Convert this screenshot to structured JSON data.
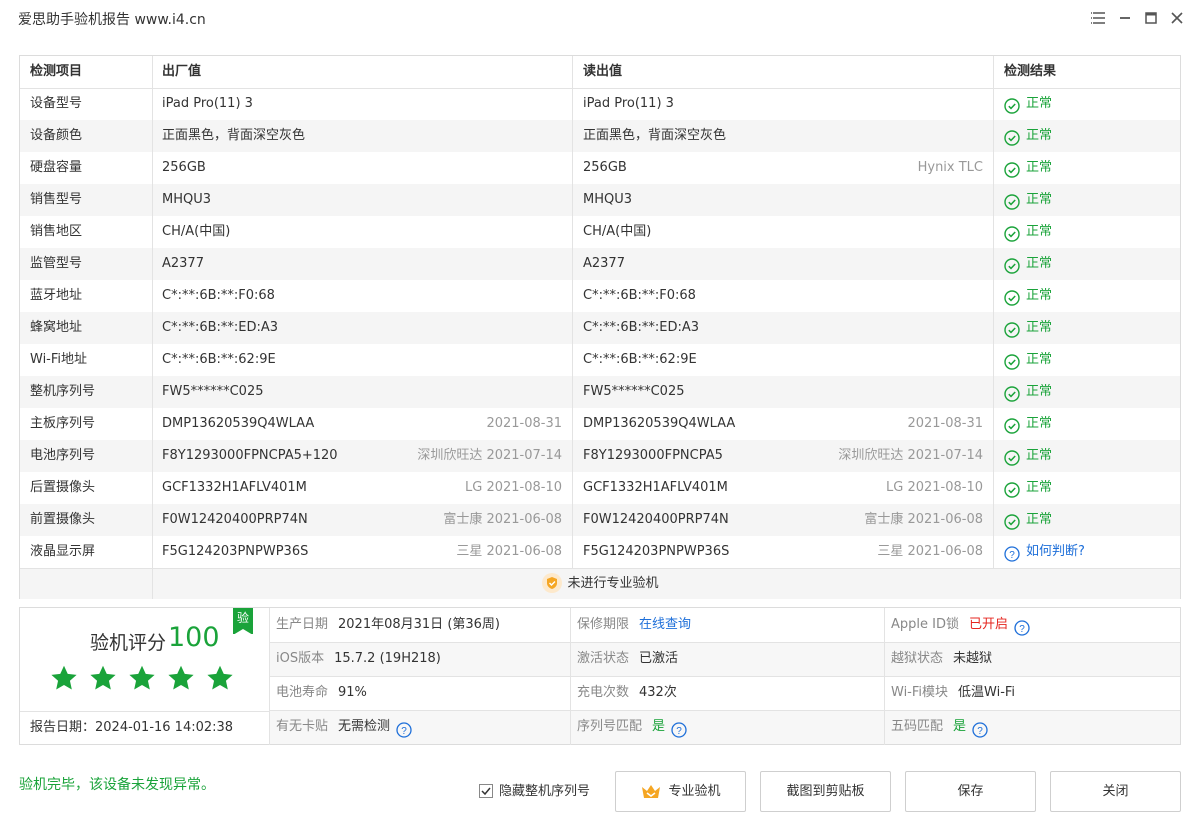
{
  "window": {
    "title": "爱思助手验机报告 www.i4.cn"
  },
  "table": {
    "headers": [
      "检测项目",
      "出厂值",
      "读出值",
      "检测结果"
    ],
    "rows": [
      {
        "item": "设备型号",
        "factory": "iPad Pro(11) 3",
        "factory_note": "",
        "read": "iPad Pro(11) 3",
        "read_note": "",
        "result": "正常",
        "result_type": "ok"
      },
      {
        "item": "设备颜色",
        "factory": "正面黑色，背面深空灰色",
        "factory_note": "",
        "read": "正面黑色，背面深空灰色",
        "read_note": "",
        "result": "正常",
        "result_type": "ok"
      },
      {
        "item": "硬盘容量",
        "factory": "256GB",
        "factory_note": "",
        "read": "256GB",
        "read_note": "Hynix TLC",
        "result": "正常",
        "result_type": "ok"
      },
      {
        "item": "销售型号",
        "factory": "MHQU3",
        "factory_note": "",
        "read": "MHQU3",
        "read_note": "",
        "result": "正常",
        "result_type": "ok"
      },
      {
        "item": "销售地区",
        "factory": "CH/A(中国)",
        "factory_note": "",
        "read": "CH/A(中国)",
        "read_note": "",
        "result": "正常",
        "result_type": "ok"
      },
      {
        "item": "监管型号",
        "factory": "A2377",
        "factory_note": "",
        "read": "A2377",
        "read_note": "",
        "result": "正常",
        "result_type": "ok"
      },
      {
        "item": "蓝牙地址",
        "factory": "C*:**:6B:**:F0:68",
        "factory_note": "",
        "read": "C*:**:6B:**:F0:68",
        "read_note": "",
        "result": "正常",
        "result_type": "ok"
      },
      {
        "item": "蜂窝地址",
        "factory": "C*:**:6B:**:ED:A3",
        "factory_note": "",
        "read": "C*:**:6B:**:ED:A3",
        "read_note": "",
        "result": "正常",
        "result_type": "ok"
      },
      {
        "item": "Wi-Fi地址",
        "factory": "C*:**:6B:**:62:9E",
        "factory_note": "",
        "read": "C*:**:6B:**:62:9E",
        "read_note": "",
        "result": "正常",
        "result_type": "ok"
      },
      {
        "item": "整机序列号",
        "factory": "FW5******C025",
        "factory_note": "",
        "read": "FW5******C025",
        "read_note": "",
        "result": "正常",
        "result_type": "ok"
      },
      {
        "item": "主板序列号",
        "factory": "DMP13620539Q4WLAA",
        "factory_note": "2021-08-31",
        "read": "DMP13620539Q4WLAA",
        "read_note": "2021-08-31",
        "result": "正常",
        "result_type": "ok"
      },
      {
        "item": "电池序列号",
        "factory": "F8Y1293000FPNCPA5+120",
        "factory_note": "深圳欣旺达 2021-07-14",
        "read": "F8Y1293000FPNCPA5",
        "read_note": "深圳欣旺达 2021-07-14",
        "result": "正常",
        "result_type": "ok"
      },
      {
        "item": "后置摄像头",
        "factory": "GCF1332H1AFLV401M",
        "factory_note": "LG 2021-08-10",
        "read": "GCF1332H1AFLV401M",
        "read_note": "LG 2021-08-10",
        "result": "正常",
        "result_type": "ok"
      },
      {
        "item": "前置摄像头",
        "factory": "F0W12420400PRP74N",
        "factory_note": "富士康 2021-06-08",
        "read": "F0W12420400PRP74N",
        "read_note": "富士康 2021-06-08",
        "result": "正常",
        "result_type": "ok"
      },
      {
        "item": "液晶显示屏",
        "factory": "F5G124203PNPWP36S",
        "factory_note": "三星 2021-06-08",
        "read": "F5G124203PNPWP36S",
        "read_note": "三星 2021-06-08",
        "result": "如何判断?",
        "result_type": "link"
      }
    ],
    "footer": "未进行专业验机"
  },
  "summary": {
    "score_label": "验机评分",
    "score_value": "100",
    "stars": 5,
    "badge": "验",
    "report_date": "报告日期：2024-01-16 14:02:38",
    "items": [
      {
        "key": "生产日期",
        "value": "2021年08月31日 (第36周)",
        "style": "normal",
        "help": false
      },
      {
        "key": "保修期限",
        "value": "在线查询",
        "style": "link",
        "help": false
      },
      {
        "key": "Apple ID锁",
        "value": "已开启",
        "style": "red",
        "help": true
      },
      {
        "key": "iOS版本",
        "value": "15.7.2 (19H218)",
        "style": "normal",
        "help": false
      },
      {
        "key": "激活状态",
        "value": "已激活",
        "style": "normal",
        "help": false
      },
      {
        "key": "越狱状态",
        "value": "未越狱",
        "style": "normal",
        "help": false
      },
      {
        "key": "电池寿命",
        "value": "91%",
        "style": "normal",
        "help": false
      },
      {
        "key": "充电次数",
        "value": "432次",
        "style": "normal",
        "help": false
      },
      {
        "key": "Wi-Fi模块",
        "value": "低温Wi-Fi",
        "style": "normal",
        "help": false
      },
      {
        "key": "有无卡贴",
        "value": "无需检测",
        "style": "normal",
        "help": true
      },
      {
        "key": "序列号匹配",
        "value": "是",
        "style": "green",
        "help": true
      },
      {
        "key": "五码匹配",
        "value": "是",
        "style": "green",
        "help": true
      }
    ]
  },
  "bottom": {
    "status": "验机完毕，该设备未发现异常。",
    "hide_serial_label": "隐藏整机序列号",
    "hide_serial_checked": true,
    "buttons": {
      "pro": "专业验机",
      "screenshot": "截图到剪贴板",
      "save": "保存",
      "close": "关闭"
    }
  },
  "colors": {
    "green": "#1aa33a",
    "red": "#e5261f",
    "link": "#1e6fd9",
    "gold": "#f5a623"
  }
}
